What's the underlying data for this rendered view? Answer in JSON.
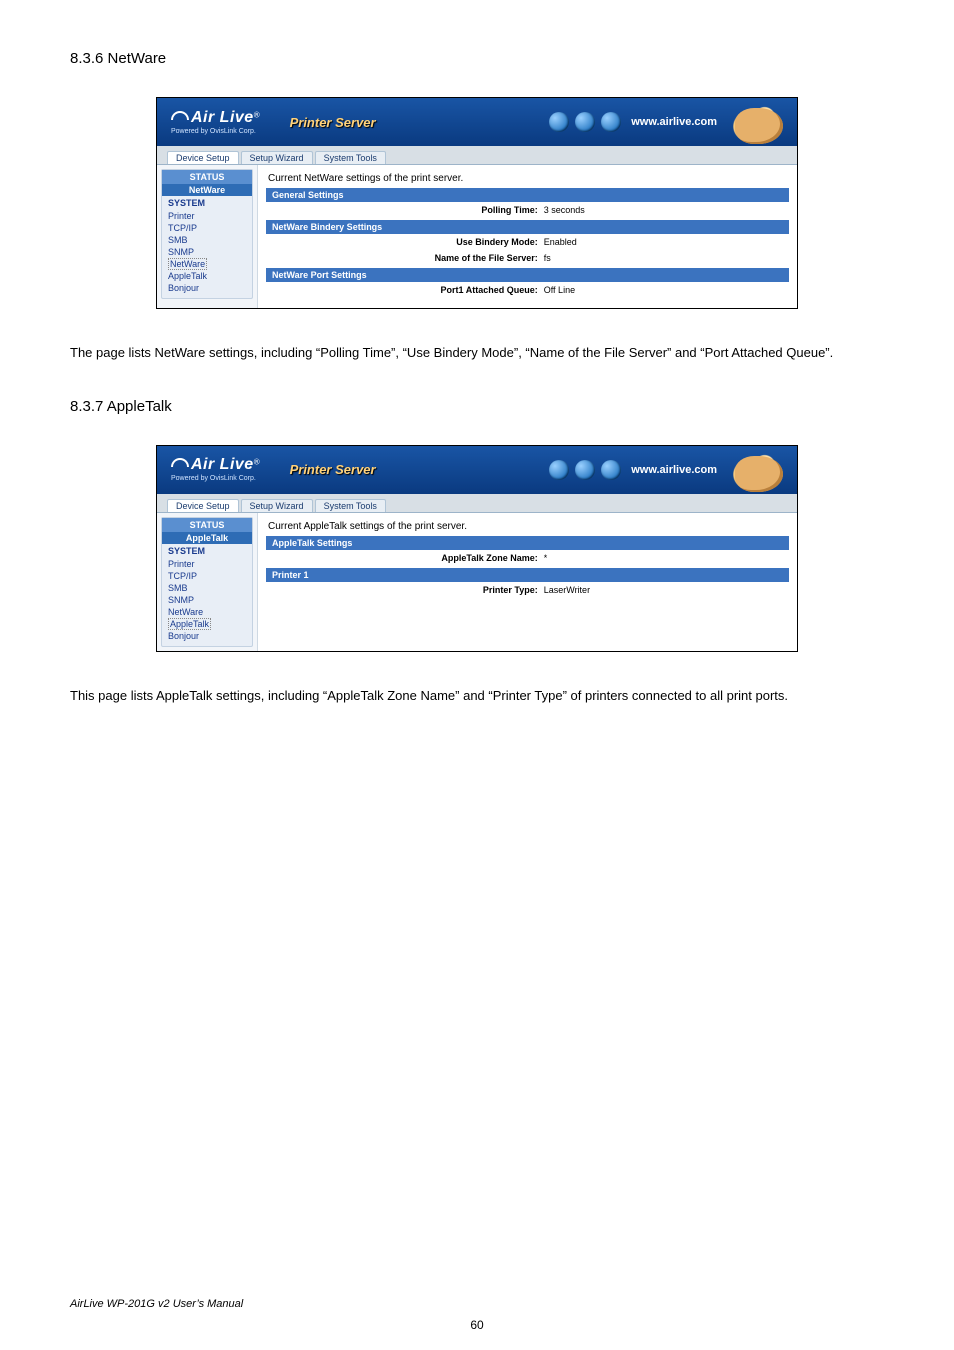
{
  "sections": {
    "netware_heading": "8.3.6 NetWare",
    "netware_paragraph": "The page lists NetWare settings, including “Polling Time”, “Use Bindery Mode”, “Name of the File Server” and “Port Attached Queue”.",
    "appletalk_heading": "8.3.7 AppleTalk",
    "appletalk_paragraph": "This page lists AppleTalk settings, including “AppleTalk Zone Name” and “Printer Type” of printers connected to all print ports."
  },
  "common": {
    "brand_top": "Air Live",
    "brand_sub": "Powered by OvisLink Corp.",
    "product_title": "Printer Server",
    "url": "www.airlive.com",
    "tabs": {
      "device_setup": "Device Setup",
      "setup_wizard": "Setup Wizard",
      "system_tools": "System Tools"
    },
    "sidebar": {
      "status": "STATUS",
      "system": "SYSTEM",
      "links": {
        "printer": "Printer",
        "tcpip": "TCP/IP",
        "smb": "SMB",
        "snmp": "SNMP",
        "netware": "NetWare",
        "appletalk": "AppleTalk",
        "bonjour": "Bonjour"
      }
    }
  },
  "netware_ss": {
    "subhead": "NetWare",
    "caption": "Current NetWare settings of the print server.",
    "bars": {
      "general": "General Settings",
      "bindery": "NetWare Bindery Settings",
      "port": "NetWare Port Settings"
    },
    "rows": {
      "polling_lbl": "Polling Time:",
      "polling_val": "3  seconds",
      "bindery_lbl": "Use Bindery Mode:",
      "bindery_val": "Enabled",
      "fileserver_lbl": "Name of the File Server:",
      "fileserver_val": "fs",
      "port_lbl": "Port1 Attached Queue:",
      "port_val": "Off Line"
    }
  },
  "appletalk_ss": {
    "subhead": "AppleTalk",
    "caption": "Current AppleTalk settings of the print server.",
    "bars": {
      "settings": "AppleTalk Settings",
      "printer1": "Printer 1"
    },
    "rows": {
      "zone_lbl": "AppleTalk Zone Name:",
      "zone_val": "*",
      "ptype_lbl": "Printer Type:",
      "ptype_val": "LaserWriter"
    }
  },
  "footer": "AirLive WP-201G v2 User’s Manual",
  "page_number": "60"
}
